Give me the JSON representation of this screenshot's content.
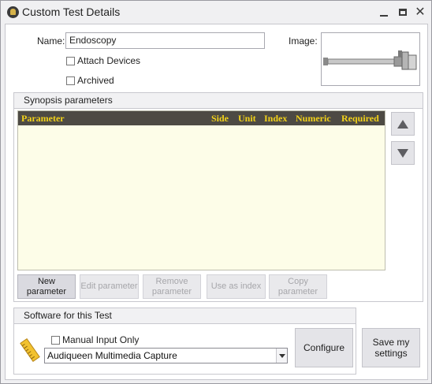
{
  "window": {
    "title": "Custom Test Details",
    "icon": "app-logo-icon",
    "controls": {
      "minimize": "minimize-icon",
      "maximize": "maximize-icon",
      "close": "✕"
    }
  },
  "details": {
    "name_label": "Name:",
    "name_value": "Endoscopy",
    "attach_devices_label": "Attach Devices",
    "attach_devices_checked": false,
    "archived_label": "Archived",
    "archived_checked": false,
    "image_label": "Image:",
    "image_icon": "endoscope-image"
  },
  "synopsis": {
    "title": "Synopsis parameters",
    "columns": [
      "Parameter",
      "Side",
      "Unit",
      "Index",
      "Numeric",
      "Required"
    ],
    "rows": [],
    "move_up_icon": "arrow-up-icon",
    "move_down_icon": "arrow-down-icon",
    "buttons": {
      "new": "New parameter",
      "edit": "Edit parameter",
      "remove": "Remove parameter",
      "use_as_index": "Use as index",
      "copy": "Copy parameter"
    }
  },
  "software": {
    "title": "Software for this Test",
    "icon": "ruler-icon",
    "manual_input_label": "Manual Input Only",
    "manual_input_checked": false,
    "selected_software": "Audiqueen Multimedia Capture",
    "configure_label": "Configure"
  },
  "footer": {
    "save_label": "Save my settings"
  },
  "colors": {
    "grid_header_bg": "#4d4a44",
    "grid_header_text": "#f2d21a",
    "grid_body_bg": "#fdfde8"
  }
}
